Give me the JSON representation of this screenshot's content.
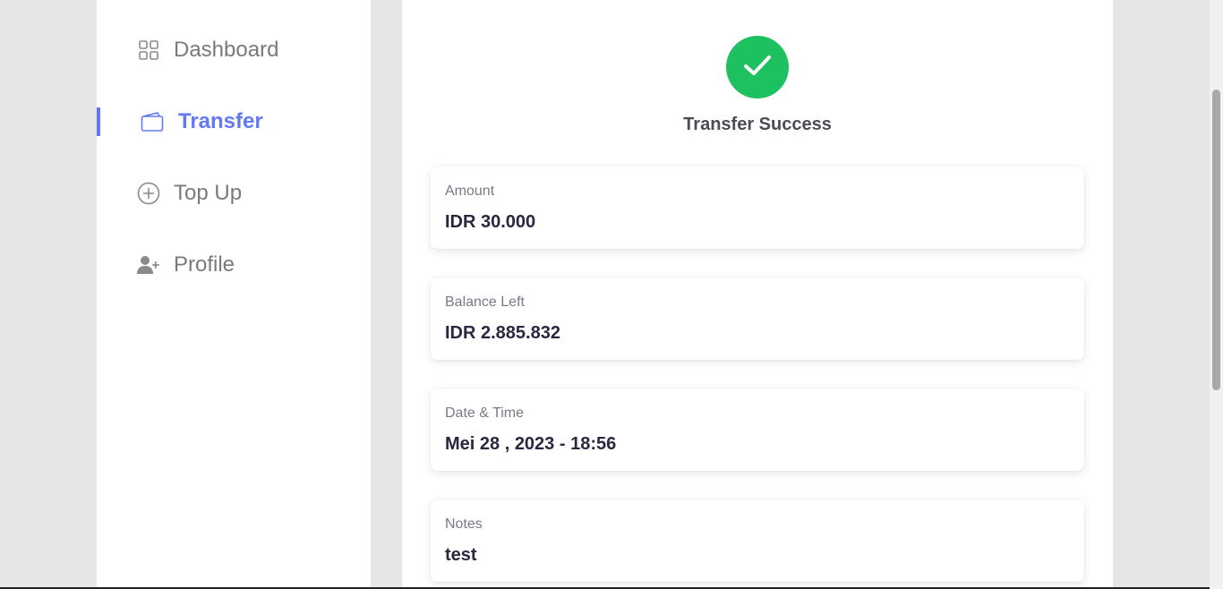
{
  "sidebar": {
    "items": [
      {
        "label": "Dashboard",
        "icon": "grid-icon",
        "active": false
      },
      {
        "label": "Transfer",
        "icon": "wallet-icon",
        "active": true
      },
      {
        "label": "Top Up",
        "icon": "plus-circle-icon",
        "active": false
      },
      {
        "label": "Profile",
        "icon": "user-add-icon",
        "active": false
      }
    ]
  },
  "main": {
    "status_icon": "check-icon",
    "title": "Transfer Success",
    "details": [
      {
        "label": "Amount",
        "value": "IDR 30.000"
      },
      {
        "label": "Balance Left",
        "value": "IDR 2.885.832"
      },
      {
        "label": "Date & Time",
        "value": "Mei 28 , 2023 - 18:56"
      },
      {
        "label": "Notes",
        "value": "test"
      }
    ]
  },
  "colors": {
    "accent": "#6379f4",
    "success": "#1ec15f",
    "muted_text": "#7a7a7a",
    "value_text": "#2c2640"
  }
}
